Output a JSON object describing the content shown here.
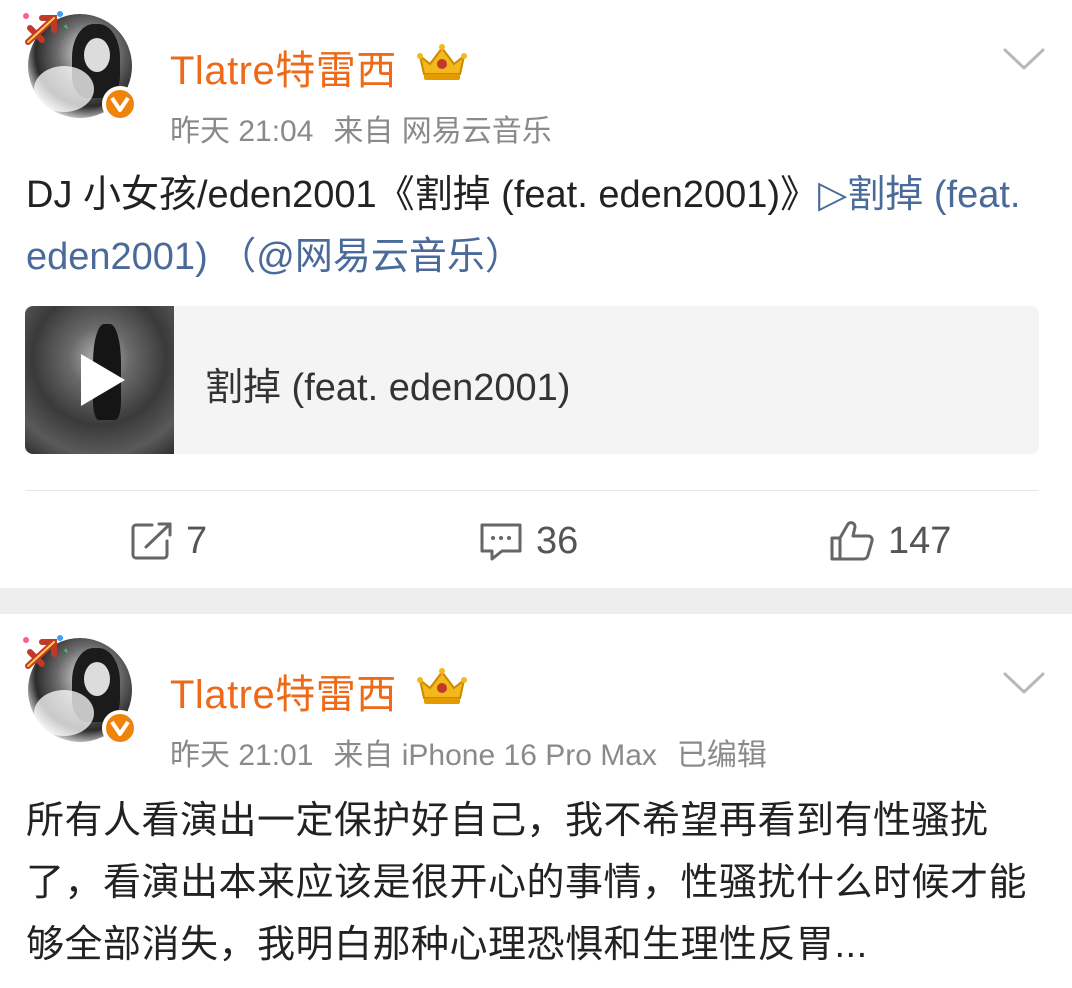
{
  "posts": [
    {
      "username": "Tlatre特雷西",
      "time": "昨天 21:04",
      "source": "来自 网易云音乐",
      "edited": "",
      "content": {
        "text": "DJ 小女孩/eden2001《割掉 (feat. eden2001)》",
        "link_play": "▷割掉 (feat. eden2001)",
        "link_source_open": " （",
        "link_source": "@网易云音乐",
        "link_source_close": "）"
      },
      "card": {
        "title": "割掉 (feat. eden2001)"
      },
      "actions": {
        "reposts": "7",
        "comments": "36",
        "likes": "147"
      }
    },
    {
      "username": "Tlatre特雷西",
      "time": "昨天 21:01",
      "source": "来自 iPhone 16 Pro Max",
      "edited": "已编辑",
      "content": {
        "text": "所有人看演出一定保护好自己，我不希望再看到有性骚扰了，看演出本来应该是很开心的事情，性骚扰什么时候才能够全部消失，我明白那种心理恐惧和生理性反胃..."
      }
    }
  ],
  "icons": {
    "repost": "repost-icon",
    "comment": "comment-icon",
    "like": "thumbs-up-icon",
    "more": "chevron-down-icon",
    "badge": "crown-badge-icon",
    "verified": "verified-v-icon",
    "zodiac": "sagittarius-icon"
  },
  "colors": {
    "username": "#ee6a19",
    "link": "#4a6a9a",
    "meta": "#8a8a8a",
    "verified": "#f0840a"
  }
}
